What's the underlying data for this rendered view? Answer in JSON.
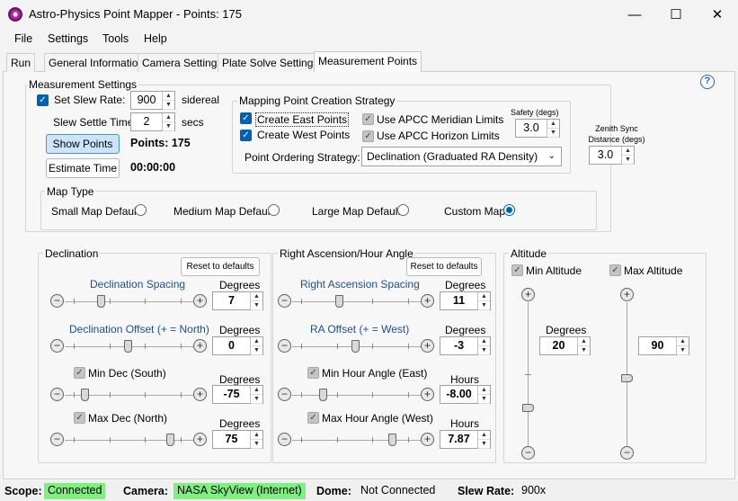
{
  "window": {
    "title": "Astro-Physics Point Mapper - Points: 175",
    "minimize": "—",
    "maximize": "☐",
    "close": "✕"
  },
  "menu": [
    "File",
    "Settings",
    "Tools",
    "Help"
  ],
  "tabs": [
    "Run",
    "General Information",
    "Camera Settings",
    "Plate Solve Settings",
    "Measurement Points"
  ],
  "help": "?",
  "measurement": {
    "group_label": "Measurement Settings",
    "slew_rate_label": "Set Slew Rate:",
    "slew_rate_value": "900",
    "slew_rate_unit": "sidereal",
    "settle_label": "Slew Settle Time",
    "settle_value": "2",
    "settle_unit": "secs",
    "show_points": "Show Points",
    "points_text": "Points: 175",
    "estimate_time": "Estimate Time",
    "time_text": "00:00:00"
  },
  "strategy": {
    "group_label": "Mapping Point Creation Strategy",
    "create_east": "Create East Points",
    "create_west": "Create West Points",
    "meridian": "Use APCC Meridian Limits",
    "horizon": "Use APCC Horizon Limits",
    "safety_label": "Safety (degs)",
    "safety_value": "3.0",
    "zenith_label_1": "Zenith Sync",
    "zenith_label_2": "Distance (degs)",
    "zenith_value": "3.0",
    "ordering_label": "Point Ordering Strategy:",
    "ordering_value": "Declination (Graduated RA Density)"
  },
  "maptype": {
    "group_label": "Map Type",
    "options": [
      "Small Map Default",
      "Medium Map Default",
      "Large Map Default",
      "Custom Map"
    ],
    "selected": 3
  },
  "declination": {
    "group_label": "Declination",
    "reset": "Reset to defaults",
    "spacing_label": "Declination Spacing",
    "spacing_unit": "Degrees",
    "spacing_value": "7",
    "offset_label": "Declination Offset (+ = North)",
    "offset_unit": "Degrees",
    "offset_value": "0",
    "min_label": "Min Dec (South)",
    "min_unit": "Degrees",
    "min_value": "-75",
    "max_label": "Max Dec (North)",
    "max_unit": "Degrees",
    "max_value": "75"
  },
  "ra": {
    "group_label": "Right Ascension/Hour Angle",
    "reset": "Reset to defaults",
    "spacing_label": "Right Ascension Spacing",
    "spacing_unit": "Degrees",
    "spacing_value": "11",
    "offset_label": "RA Offset (+ = West)",
    "offset_unit": "Degrees",
    "offset_value": "-3",
    "min_label": "Min Hour Angle (East)",
    "min_unit": "Hours",
    "min_value": "-8.00",
    "max_label": "Max Hour Angle (West)",
    "max_unit": "Hours",
    "max_value": "7.87"
  },
  "altitude": {
    "group_label": "Altitude",
    "min_label": "Min Altitude",
    "max_label": "Max Altitude",
    "unit": "Degrees",
    "min_value": "20",
    "max_value": "90"
  },
  "sliders": {
    "dec_spacing": 0.25,
    "dec_offset": 0.5,
    "dec_min": 0.1,
    "dec_max": 0.9,
    "ra_spacing": 0.35,
    "ra_offset": 0.5,
    "ra_min": 0.2,
    "ra_max": 0.85,
    "alt_min": 0.22,
    "alt_max": 0.45
  },
  "status": {
    "scope_label": "Scope:",
    "scope_value": "Connected",
    "camera_label": "Camera:",
    "camera_value": "NASA SkyView (Internet)",
    "dome_label": "Dome:",
    "dome_value": "Not Connected",
    "slew_label": "Slew Rate:",
    "slew_value": "900x"
  }
}
